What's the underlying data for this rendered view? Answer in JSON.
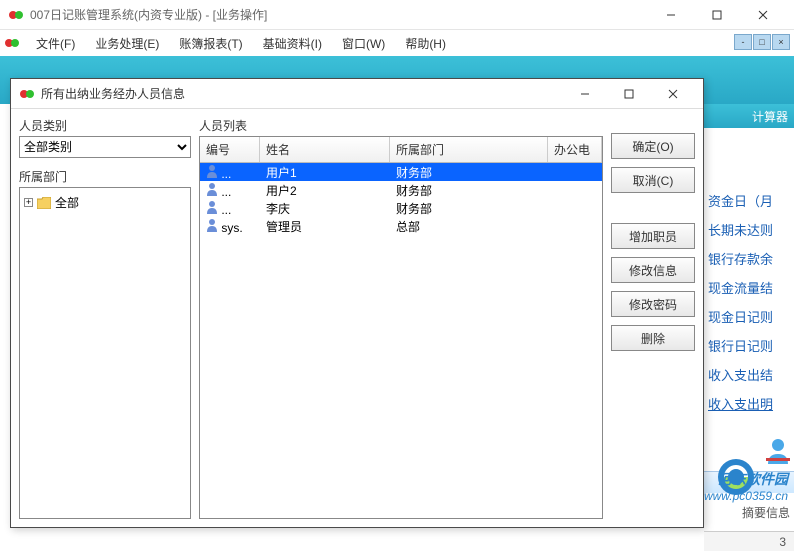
{
  "main_window": {
    "title": "007日记账管理系统(内资专业版) - [业务操作]"
  },
  "menubar": {
    "items": [
      "文件(F)",
      "业务处理(E)",
      "账簿报表(T)",
      "基础资料(I)",
      "窗口(W)",
      "帮助(H)"
    ]
  },
  "toolbar_right_label": "计算器",
  "right_panel": {
    "links": [
      "资金日（月",
      "长期未达则",
      "银行存款余",
      "现金流量结",
      "现金日记则",
      "银行日记则",
      "收入支出结",
      "收入支出明"
    ],
    "summary_label": "摘要信息"
  },
  "dialog": {
    "title": "所有出纳业务经办人员信息",
    "left": {
      "category_label": "人员类别",
      "category_value": "全部类别",
      "dept_label": "所属部门",
      "tree_root": "全部"
    },
    "list": {
      "title": "人员列表",
      "columns": [
        "编号",
        "姓名",
        "所属部门",
        "办公电"
      ],
      "rows": [
        {
          "code": "...",
          "name": "用户1",
          "dept": "财务部",
          "selected": true
        },
        {
          "code": "...",
          "name": "用户2",
          "dept": "财务部",
          "selected": false
        },
        {
          "code": "...",
          "name": "李庆",
          "dept": "财务部",
          "selected": false
        },
        {
          "code": "sys.",
          "name": "管理员",
          "dept": "总部",
          "selected": false
        }
      ]
    },
    "buttons": {
      "ok": "确定(O)",
      "cancel": "取消(C)",
      "add": "增加职员",
      "edit": "修改信息",
      "pwd": "修改密码",
      "del": "删除"
    }
  },
  "watermark": {
    "text": "河东软件园",
    "url": "www.pc0359.cn"
  },
  "footer_num": "3"
}
